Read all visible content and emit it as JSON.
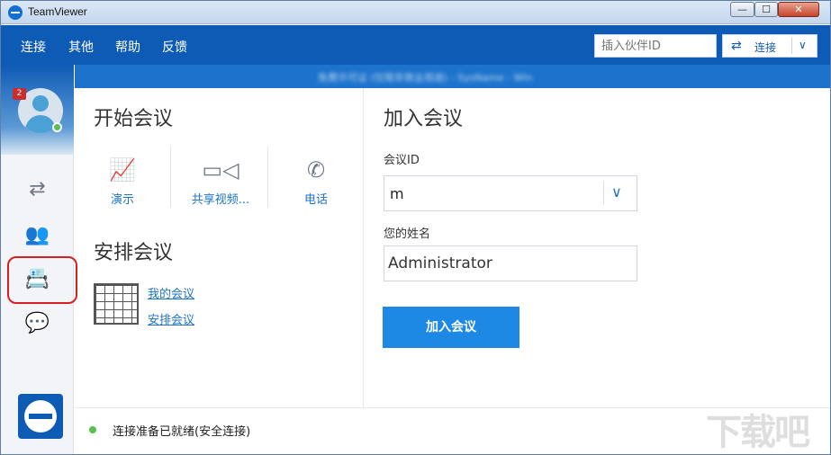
{
  "window": {
    "title": "TeamViewer",
    "min_glyph": "—",
    "max_glyph": "☐",
    "close_glyph": "✕"
  },
  "menu": {
    "items": [
      "连接",
      "其他",
      "帮助",
      "反馈"
    ],
    "partner_placeholder": "插入伙伴ID",
    "connect_arrow": "⇄",
    "connect_label": "连接",
    "connect_caret": "∨"
  },
  "sidebar": {
    "badge_count": "2",
    "icons": [
      "remote-control-icon",
      "meeting-icon",
      "contacts-icon",
      "chat-icon"
    ],
    "glyphs": {
      "remote": "⇄",
      "meeting": "👥",
      "contacts": "📇",
      "chat": "💬"
    }
  },
  "info_strip": {
    "text": "免费许可证 (仅限非商业用途) - SysName - Win"
  },
  "start_meeting": {
    "heading": "开始会议",
    "actions": [
      {
        "icon": "presentation-icon",
        "glyph": "📈",
        "label": "演示"
      },
      {
        "icon": "video-icon",
        "glyph": "▭◁",
        "label": "共享视频..."
      },
      {
        "icon": "phone-icon",
        "glyph": "✆",
        "label": "电话"
      }
    ]
  },
  "schedule_meeting": {
    "heading": "安排会议",
    "links": [
      "我的会议",
      "安排会议"
    ]
  },
  "join_meeting": {
    "heading": "加入会议",
    "id_label": "会议ID",
    "id_value": "m",
    "id_caret": "∨",
    "name_label": "您的姓名",
    "name_value": "Administrator",
    "join_button": "加入会议"
  },
  "status": {
    "text": "连接准备已就绪(安全连接)",
    "color": "#55c14a"
  },
  "watermark": "下载吧",
  "colors": {
    "menu_bg": "#0e5bb5",
    "accent": "#1e88e5",
    "link": "#1e73c8",
    "highlight_border": "#d62020"
  }
}
